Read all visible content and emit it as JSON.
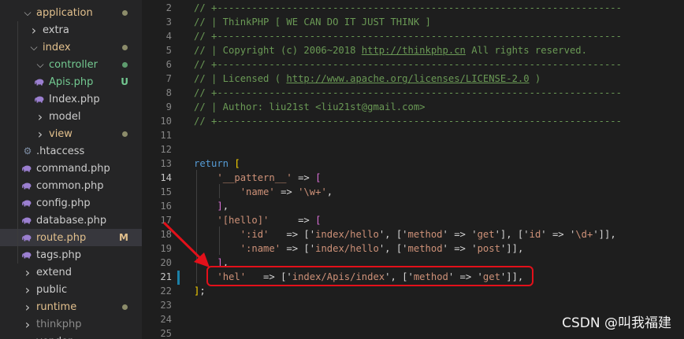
{
  "colors": {
    "modified": "#e2c08d",
    "untracked": "#73c991",
    "folder_dot": "#8c8c6a",
    "highlight_red": "#e3101a"
  },
  "explorer": {
    "items": [
      {
        "label": "application",
        "chevron": "v",
        "color": "#e2c08d",
        "dot": true,
        "dot_color": "#8c8c6a"
      },
      {
        "label": "extra",
        "chevron": ">",
        "color": "#cccccc"
      },
      {
        "label": "index",
        "chevron": "v",
        "color": "#e2c08d",
        "dot": true,
        "dot_color": "#8c8c6a"
      },
      {
        "label": "controller",
        "chevron": "v",
        "color": "#73c991",
        "dot": true,
        "dot_color": "#5e9c6e"
      },
      {
        "label": "Apis.php",
        "icon": "php-elephant-icon",
        "color": "#73c991",
        "status": "U",
        "status_color": "#73c991"
      },
      {
        "label": "Index.php",
        "icon": "php-elephant-icon",
        "color": "#cccccc"
      },
      {
        "label": "model",
        "chevron": ">",
        "color": "#cccccc"
      },
      {
        "label": "view",
        "chevron": ">",
        "color": "#e2c08d",
        "dot": true,
        "dot_color": "#8c8c6a"
      },
      {
        "label": ".htaccess",
        "icon": "gear-icon",
        "color": "#cccccc"
      },
      {
        "label": "command.php",
        "icon": "php-elephant-icon",
        "color": "#cccccc"
      },
      {
        "label": "common.php",
        "icon": "php-elephant-icon",
        "color": "#cccccc"
      },
      {
        "label": "config.php",
        "icon": "php-elephant-icon",
        "color": "#cccccc"
      },
      {
        "label": "database.php",
        "icon": "php-elephant-icon",
        "color": "#cccccc"
      },
      {
        "label": "route.php",
        "icon": "php-elephant-icon",
        "color": "#e2c08d",
        "status": "M",
        "status_color": "#e2c08d",
        "selected": true
      },
      {
        "label": "tags.php",
        "icon": "php-elephant-icon",
        "color": "#cccccc"
      },
      {
        "label": "extend",
        "chevron": ">",
        "color": "#cccccc"
      },
      {
        "label": "public",
        "chevron": ">",
        "color": "#cccccc"
      },
      {
        "label": "runtime",
        "chevron": ">",
        "color": "#e2c08d",
        "dot": true,
        "dot_color": "#8c8c6a"
      },
      {
        "label": "thinkphp",
        "chevron": ">",
        "color": "#8b8b8b"
      },
      {
        "label": "vendor",
        "chevron": ">",
        "color": "#cccccc"
      }
    ]
  },
  "editor": {
    "active_line": "21",
    "lines": [
      {
        "n": "2",
        "tokens": [
          {
            "t": "// +----------------------------------------------------------------------",
            "c": "c"
          }
        ]
      },
      {
        "n": "3",
        "tokens": [
          {
            "t": "// | ThinkPHP [ WE CAN DO IT JUST THINK ]",
            "c": "c"
          }
        ]
      },
      {
        "n": "4",
        "tokens": [
          {
            "t": "// +----------------------------------------------------------------------",
            "c": "c"
          }
        ]
      },
      {
        "n": "5",
        "tokens": [
          {
            "t": "// | Copyright (c) 2006~2018 ",
            "c": "c"
          },
          {
            "t": "http://thinkphp.cn",
            "c": "c u"
          },
          {
            "t": " All rights reserved.",
            "c": "c"
          }
        ]
      },
      {
        "n": "6",
        "tokens": [
          {
            "t": "// +----------------------------------------------------------------------",
            "c": "c"
          }
        ]
      },
      {
        "n": "7",
        "tokens": [
          {
            "t": "// | Licensed ( ",
            "c": "c"
          },
          {
            "t": "http://www.apache.org/licenses/LICENSE-2.0",
            "c": "c u"
          },
          {
            "t": " )",
            "c": "c"
          }
        ]
      },
      {
        "n": "8",
        "tokens": [
          {
            "t": "// +----------------------------------------------------------------------",
            "c": "c"
          }
        ]
      },
      {
        "n": "9",
        "tokens": [
          {
            "t": "// | Author: liu21st <liu21st@gmail.com>",
            "c": "c"
          }
        ]
      },
      {
        "n": "10",
        "tokens": [
          {
            "t": "// +----------------------------------------------------------------------",
            "c": "c"
          }
        ]
      },
      {
        "n": "11",
        "tokens": []
      },
      {
        "n": "12",
        "tokens": []
      },
      {
        "n": "13",
        "tokens": [
          {
            "t": "return",
            "c": "k"
          },
          {
            "t": " ",
            "c": "p"
          },
          {
            "t": "[",
            "c": "y"
          }
        ]
      },
      {
        "n": "14",
        "tokens": [
          {
            "t": "    ",
            "c": "p"
          },
          {
            "t": "'__pattern__'",
            "c": "s"
          },
          {
            "t": " => ",
            "c": "p"
          },
          {
            "t": "[",
            "c": "v"
          }
        ]
      },
      {
        "n": "15",
        "tokens": [
          {
            "t": "        ",
            "c": "p"
          },
          {
            "t": "'name'",
            "c": "s"
          },
          {
            "t": " => ",
            "c": "p"
          },
          {
            "t": "'\\w+'",
            "c": "s"
          },
          {
            "t": ",",
            "c": "p"
          }
        ]
      },
      {
        "n": "16",
        "tokens": [
          {
            "t": "    ",
            "c": "p"
          },
          {
            "t": "]",
            "c": "v"
          },
          {
            "t": ",",
            "c": "p"
          }
        ]
      },
      {
        "n": "17",
        "tokens": [
          {
            "t": "    ",
            "c": "p"
          },
          {
            "t": "'[hello]'",
            "c": "s"
          },
          {
            "t": "     => ",
            "c": "p"
          },
          {
            "t": "[",
            "c": "v"
          }
        ]
      },
      {
        "n": "18",
        "tokens": [
          {
            "t": "        ",
            "c": "p"
          },
          {
            "t": "':id'",
            "c": "s"
          },
          {
            "t": "   => ['",
            "c": "p"
          },
          {
            "t": "index/hello",
            "c": "s"
          },
          {
            "t": "', ['",
            "c": "p"
          },
          {
            "t": "method",
            "c": "s"
          },
          {
            "t": "' => '",
            "c": "p"
          },
          {
            "t": "get",
            "c": "s"
          },
          {
            "t": "'], ['",
            "c": "p"
          },
          {
            "t": "id",
            "c": "s"
          },
          {
            "t": "' => '",
            "c": "p"
          },
          {
            "t": "\\d+",
            "c": "s"
          },
          {
            "t": "']],",
            "c": "p"
          }
        ]
      },
      {
        "n": "19",
        "tokens": [
          {
            "t": "        ",
            "c": "p"
          },
          {
            "t": "':name'",
            "c": "s"
          },
          {
            "t": " => ['",
            "c": "p"
          },
          {
            "t": "index/hello",
            "c": "s"
          },
          {
            "t": "', ['",
            "c": "p"
          },
          {
            "t": "method",
            "c": "s"
          },
          {
            "t": "' => '",
            "c": "p"
          },
          {
            "t": "post",
            "c": "s"
          },
          {
            "t": "']],",
            "c": "p"
          }
        ]
      },
      {
        "n": "20",
        "tokens": [
          {
            "t": "    ",
            "c": "p"
          },
          {
            "t": "]",
            "c": "v"
          },
          {
            "t": ",",
            "c": "p"
          }
        ]
      },
      {
        "n": "21",
        "tokens": [
          {
            "t": "    ",
            "c": "p"
          },
          {
            "t": "'hel'",
            "c": "s"
          },
          {
            "t": "   => ['",
            "c": "p"
          },
          {
            "t": "index/Apis/index",
            "c": "s"
          },
          {
            "t": "', ['",
            "c": "p"
          },
          {
            "t": "method",
            "c": "s"
          },
          {
            "t": "' => '",
            "c": "p"
          },
          {
            "t": "get",
            "c": "s"
          },
          {
            "t": "']],",
            "c": "p"
          }
        ]
      },
      {
        "n": "22",
        "tokens": [
          {
            "t": "]",
            "c": "y"
          },
          {
            "t": ";",
            "c": "p"
          }
        ]
      },
      {
        "n": "23",
        "tokens": []
      },
      {
        "n": "24",
        "tokens": []
      },
      {
        "n": "25",
        "tokens": []
      }
    ]
  },
  "watermark": "CSDN @叫我福建"
}
